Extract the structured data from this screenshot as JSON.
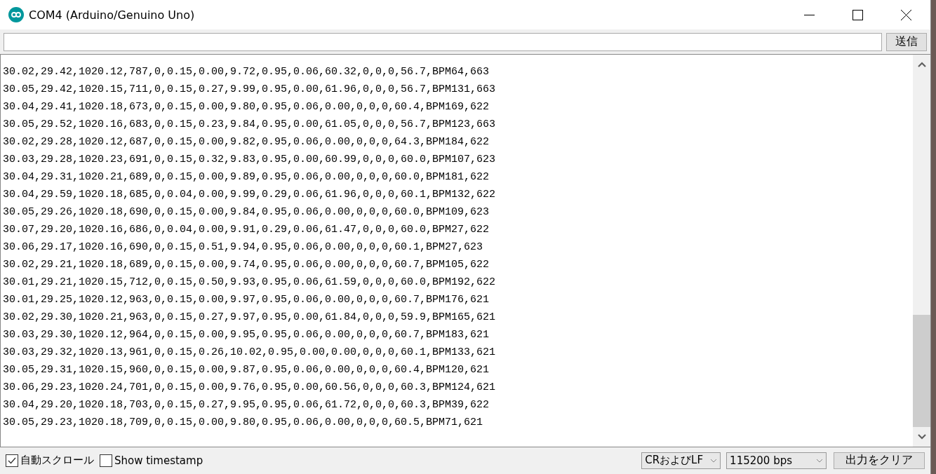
{
  "window": {
    "title": "COM4 (Arduino/Genuino Uno)"
  },
  "send_button": "送信",
  "output_lines": [
    "30.02,29.42,1020.12,787,0,0.15,0.00,9.72,0.95,0.06,60.32,0,0,0,56.7,BPM64,663",
    "30.05,29.42,1020.15,711,0,0.15,0.27,9.99,0.95,0.00,61.96,0,0,0,56.7,BPM131,663",
    "30.04,29.41,1020.18,673,0,0.15,0.00,9.80,0.95,0.06,0.00,0,0,0,60.4,BPM169,622",
    "30.05,29.52,1020.16,683,0,0.15,0.23,9.84,0.95,0.00,61.05,0,0,0,56.7,BPM123,663",
    "30.02,29.28,1020.12,687,0,0.15,0.00,9.82,0.95,0.06,0.00,0,0,0,64.3,BPM184,622",
    "30.03,29.28,1020.23,691,0,0.15,0.32,9.83,0.95,0.00,60.99,0,0,0,60.0,BPM107,623",
    "30.04,29.31,1020.21,689,0,0.15,0.00,9.89,0.95,0.06,0.00,0,0,0,60.0,BPM181,622",
    "30.04,29.59,1020.18,685,0,0.04,0.00,9.99,0.29,0.06,61.96,0,0,0,60.1,BPM132,622",
    "30.05,29.26,1020.18,690,0,0.15,0.00,9.84,0.95,0.06,0.00,0,0,0,60.0,BPM109,623",
    "30.07,29.20,1020.16,686,0,0.04,0.00,9.91,0.29,0.06,61.47,0,0,0,60.0,BPM27,622",
    "30.06,29.17,1020.16,690,0,0.15,0.51,9.94,0.95,0.06,0.00,0,0,0,60.1,BPM27,623",
    "30.02,29.21,1020.18,689,0,0.15,0.00,9.74,0.95,0.06,0.00,0,0,0,60.7,BPM105,622",
    "30.01,29.21,1020.15,712,0,0.15,0.50,9.93,0.95,0.06,61.59,0,0,0,60.0,BPM192,622",
    "30.01,29.25,1020.12,963,0,0.15,0.00,9.97,0.95,0.06,0.00,0,0,0,60.7,BPM176,621",
    "30.02,29.30,1020.21,963,0,0.15,0.27,9.97,0.95,0.00,61.84,0,0,0,59.9,BPM165,621",
    "30.03,29.30,1020.12,964,0,0.15,0.00,9.95,0.95,0.06,0.00,0,0,0,60.7,BPM183,621",
    "30.03,29.32,1020.13,961,0,0.15,0.26,10.02,0.95,0.00,0.00,0,0,0,60.1,BPM133,621",
    "30.05,29.31,1020.15,960,0,0.15,0.00,9.87,0.95,0.06,0.00,0,0,0,60.4,BPM120,621",
    "30.06,29.23,1020.24,701,0,0.15,0.00,9.76,0.95,0.00,60.56,0,0,0,60.3,BPM124,621",
    "30.04,29.20,1020.18,703,0,0.15,0.27,9.95,0.95,0.06,61.72,0,0,0,60.3,BPM39,622",
    "30.05,29.23,1020.18,709,0,0.15,0.00,9.80,0.95,0.06,0.00,0,0,0,60.5,BPM71,621"
  ],
  "checkboxes": [
    {
      "label": "自動スクロール",
      "checked": true
    },
    {
      "label": "Show timestamp",
      "checked": false
    }
  ],
  "line_ending": "CRおよびLF",
  "baud_rate": "115200 bps",
  "clear_button": "出力をクリア"
}
